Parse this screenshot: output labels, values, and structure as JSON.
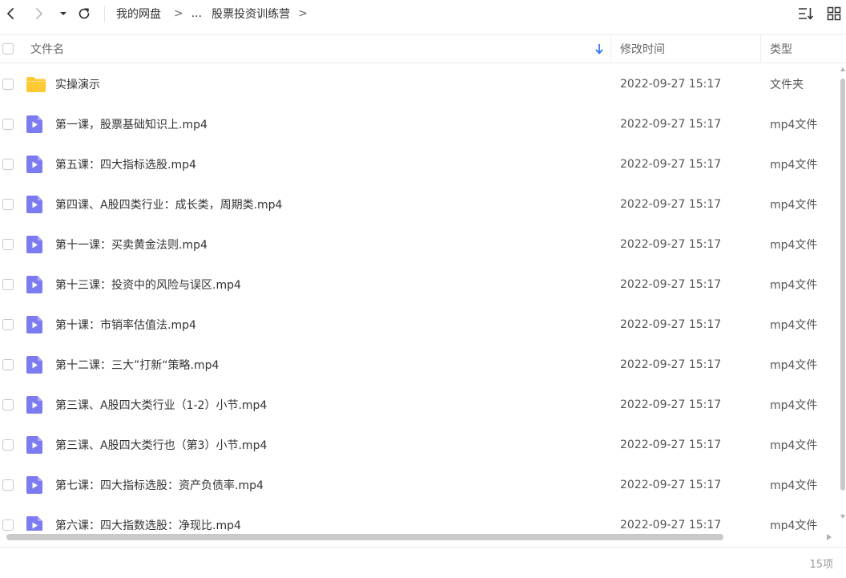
{
  "toolbar": {
    "breadcrumb": {
      "root": "我的网盘",
      "sep1": ">",
      "ellipsis": "...",
      "current": "股票投资训练营",
      "sep2": ">"
    },
    "icons": [
      "back-icon",
      "forward-icon",
      "dropdown-icon",
      "refresh-icon",
      "sort-list-icon",
      "grid-view-icon"
    ]
  },
  "header": {
    "name": "文件名",
    "modified": "修改时间",
    "type": "类型"
  },
  "colors": {
    "folder": "#FFC933",
    "video_icon": "#7D7BF0",
    "sort_arrow": "#2F7CF6"
  },
  "files": [
    {
      "name": "实操演示",
      "date": "2022-09-27 15:17",
      "type": "文件夹",
      "icon": "folder-icon"
    },
    {
      "name": "第一课，股票基础知识上.mp4",
      "date": "2022-09-27 15:17",
      "type": "mp4文件",
      "icon": "video-file-icon"
    },
    {
      "name": "第五课：四大指标选股.mp4",
      "date": "2022-09-27 15:17",
      "type": "mp4文件",
      "icon": "video-file-icon"
    },
    {
      "name": "第四课、A股四类行业：成长类，周期类.mp4",
      "date": "2022-09-27 15:17",
      "type": "mp4文件",
      "icon": "video-file-icon"
    },
    {
      "name": "第十一课：买卖黄金法则.mp4",
      "date": "2022-09-27 15:17",
      "type": "mp4文件",
      "icon": "video-file-icon"
    },
    {
      "name": "第十三课：投资中的风险与误区.mp4",
      "date": "2022-09-27 15:17",
      "type": "mp4文件",
      "icon": "video-file-icon"
    },
    {
      "name": "第十课：市销率估值法.mp4",
      "date": "2022-09-27 15:17",
      "type": "mp4文件",
      "icon": "video-file-icon"
    },
    {
      "name": "第十二课：三大”打新“策略.mp4",
      "date": "2022-09-27 15:17",
      "type": "mp4文件",
      "icon": "video-file-icon"
    },
    {
      "name": "第三课、A股四大类行业（1-2）小节.mp4",
      "date": "2022-09-27 15:17",
      "type": "mp4文件",
      "icon": "video-file-icon"
    },
    {
      "name": "第三课、A股四大类行也（第3）小节.mp4",
      "date": "2022-09-27 15:17",
      "type": "mp4文件",
      "icon": "video-file-icon"
    },
    {
      "name": "第七课：四大指标选股：资产负债率.mp4",
      "date": "2022-09-27 15:17",
      "type": "mp4文件",
      "icon": "video-file-icon"
    },
    {
      "name": "第六课：四大指数选股：净现比.mp4",
      "date": "2022-09-27 15:17",
      "type": "mp4文件",
      "icon": "video-file-icon"
    }
  ],
  "status": {
    "count": "15项"
  }
}
